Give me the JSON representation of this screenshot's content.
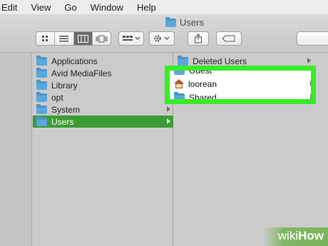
{
  "menubar": {
    "items": [
      "Edit",
      "View",
      "Go",
      "Window",
      "Help"
    ]
  },
  "window": {
    "title": "Users"
  },
  "toolbar": {
    "view_modes": [
      "icon-view",
      "list-view",
      "column-view",
      "cover-flow-view"
    ],
    "selected_view": "column-view",
    "arrange_icon": "arrange-icon",
    "action_icon": "gear-icon",
    "share_icon": "share-icon",
    "tag_icon": "tag-icon"
  },
  "column1": {
    "items": [
      {
        "label": "Applications",
        "icon": "folder-icon"
      },
      {
        "label": "Avid MediaFiles",
        "icon": "folder-icon"
      },
      {
        "label": "Library",
        "icon": "folder-icon"
      },
      {
        "label": "opt",
        "icon": "folder-icon"
      },
      {
        "label": "System",
        "icon": "folder-icon"
      },
      {
        "label": "Users",
        "icon": "folder-icon",
        "selected": true
      }
    ]
  },
  "column2": {
    "items": [
      {
        "label": "Deleted Users",
        "icon": "folder-icon"
      },
      {
        "label": "Guest",
        "icon": "folder-icon"
      },
      {
        "label": "loorean",
        "icon": "home-icon"
      },
      {
        "label": "Shared",
        "icon": "folder-icon"
      }
    ]
  },
  "colors": {
    "selection": "#3c9c34",
    "highlight_border": "#38ec27",
    "folder": "#5aa7dc"
  },
  "watermark": {
    "part1": "wiki",
    "part2": "How"
  }
}
